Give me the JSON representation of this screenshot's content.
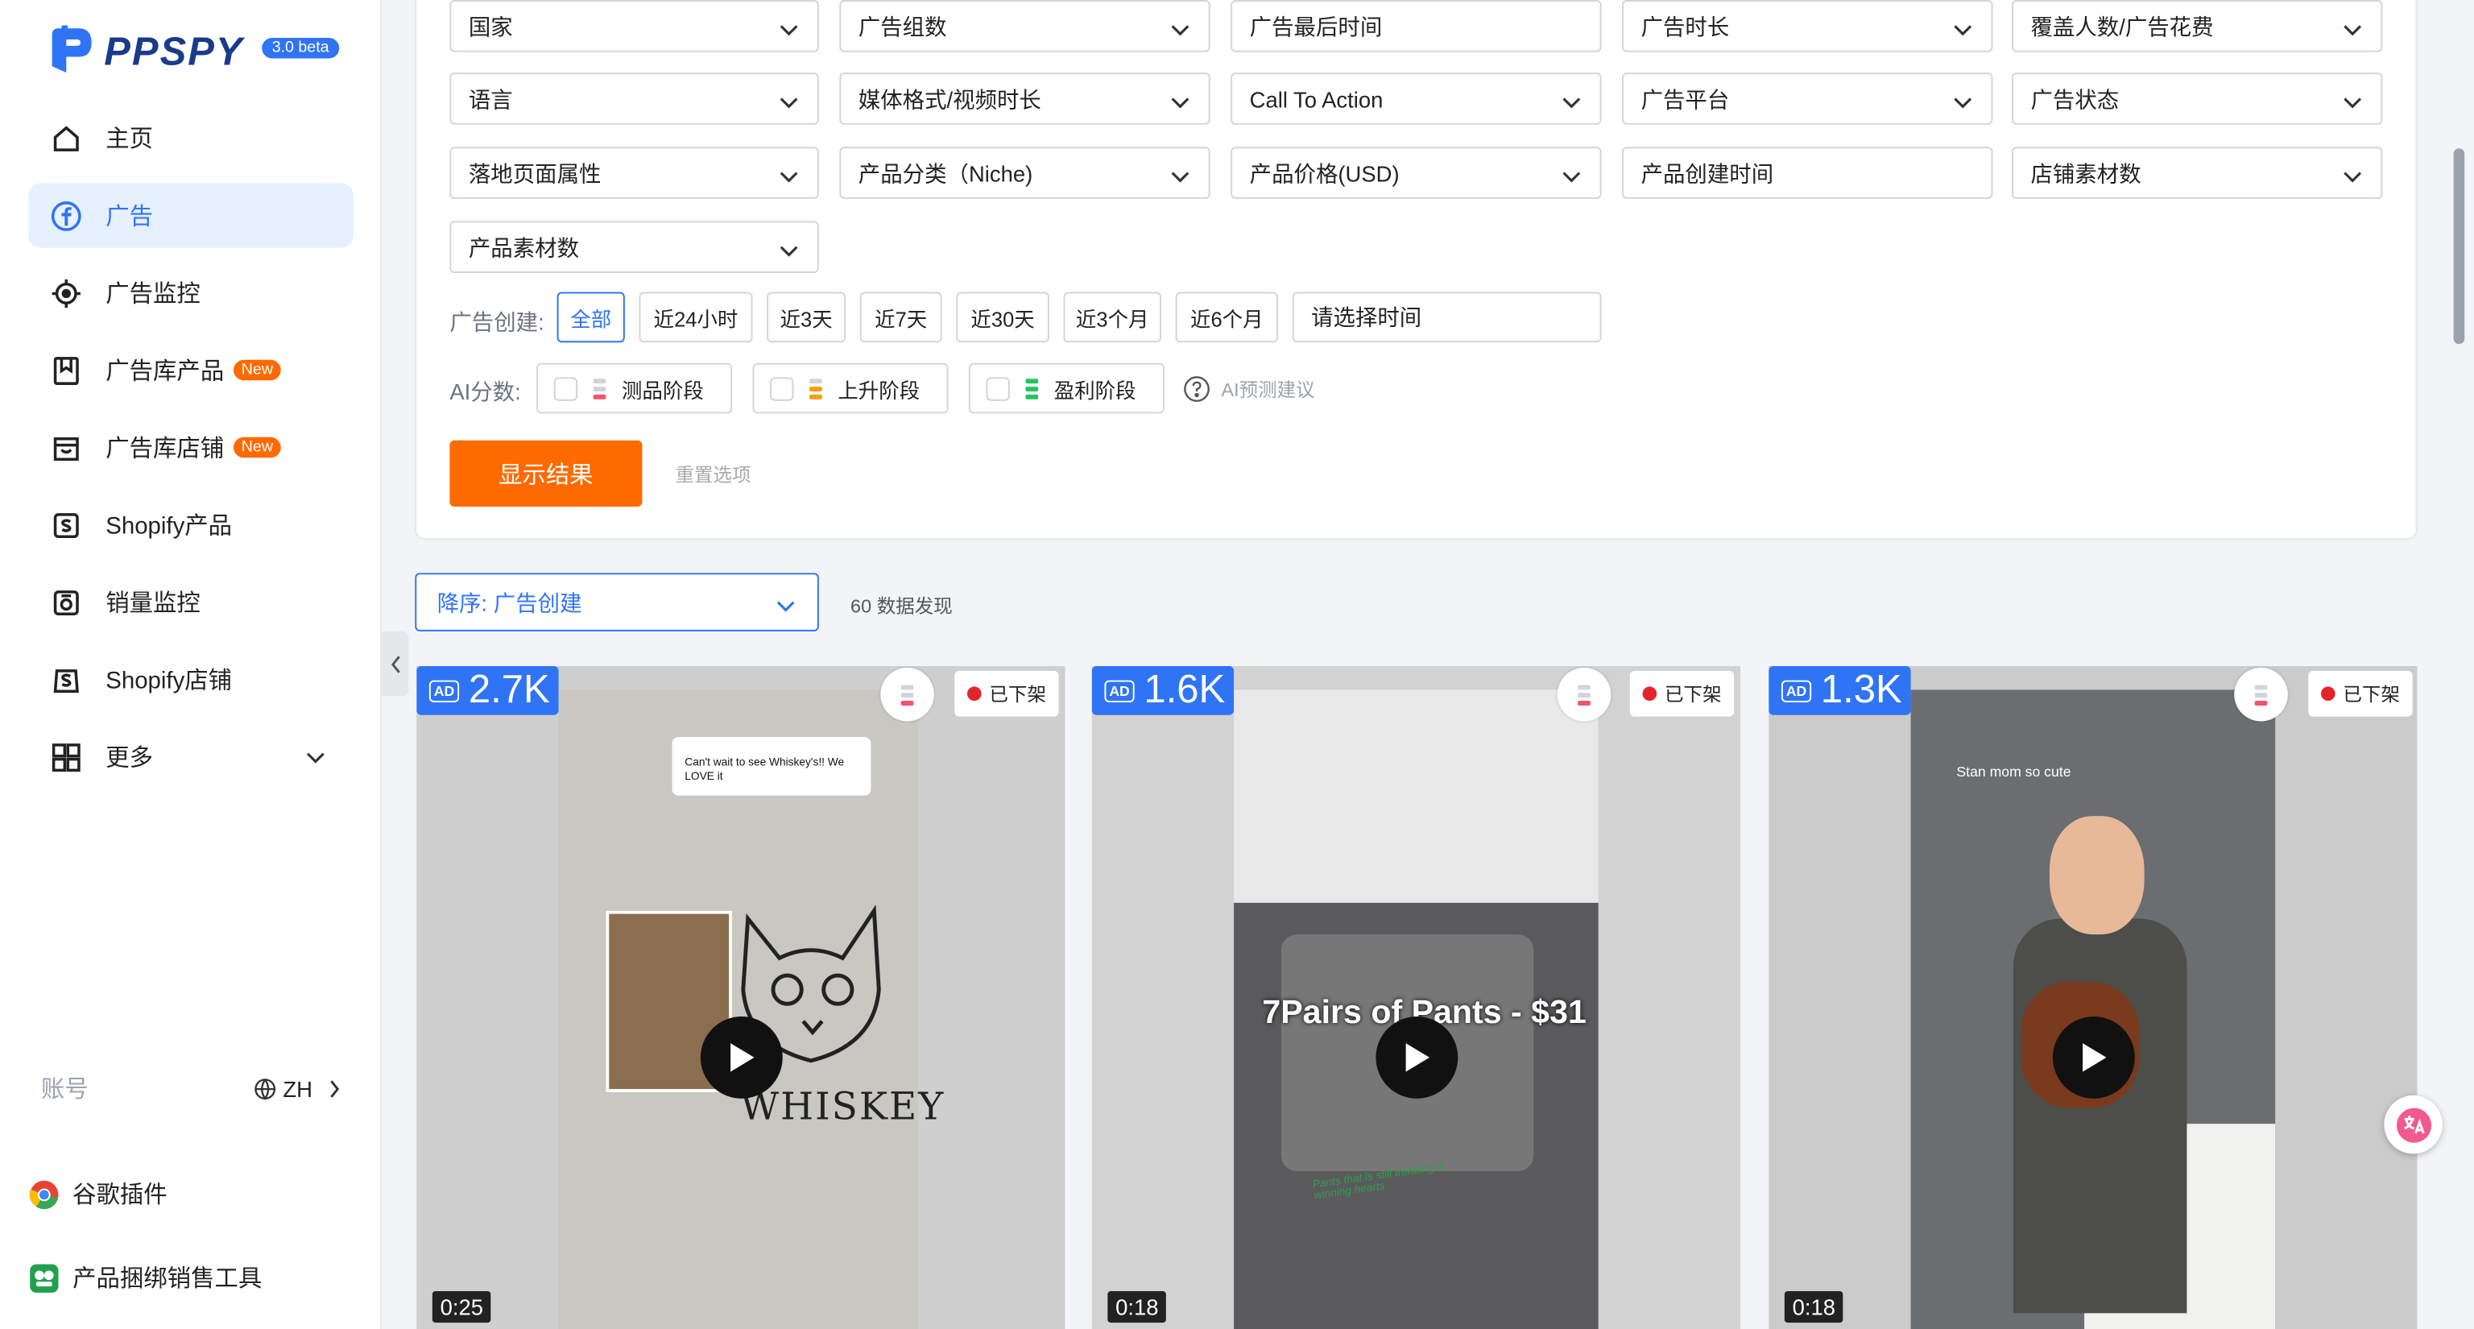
{
  "brand": {
    "name": "PPSPY",
    "version": "3.0 beta"
  },
  "nav": [
    {
      "label": "主页",
      "icon": "home-icon"
    },
    {
      "label": "广告",
      "icon": "facebook-icon",
      "active": true
    },
    {
      "label": "广告监控",
      "icon": "target-icon"
    },
    {
      "label": "广告库产品",
      "icon": "bookmark-icon",
      "badge": "New"
    },
    {
      "label": "广告库店铺",
      "icon": "store-icon",
      "badge": "New"
    },
    {
      "label": "Shopify产品",
      "icon": "shopify-icon"
    },
    {
      "label": "销量监控",
      "icon": "sales-monitor-icon"
    },
    {
      "label": "Shopify店铺",
      "icon": "shopify-store-icon"
    },
    {
      "label": "更多",
      "icon": "grid-icon"
    }
  ],
  "account": {
    "label": "账号",
    "lang": "ZH"
  },
  "plugins": [
    {
      "label": "谷歌插件",
      "icon": "chrome-icon"
    },
    {
      "label": "产品捆绑销售工具",
      "icon": "bundle-tool-icon"
    }
  ],
  "filters": {
    "row1": [
      "国家",
      "广告组数",
      "广告最后时间",
      "广告时长",
      "覆盖人数/广告花费"
    ],
    "row2": [
      "语言",
      "媒体格式/视频时长",
      "Call To Action",
      "广告平台",
      "广告状态"
    ],
    "row3": [
      "落地页面属性",
      "产品分类（Niche)",
      "产品价格(USD)",
      "产品创建时间",
      "店铺素材数"
    ],
    "row4": [
      "产品素材数"
    ],
    "date_label": "广告创建:",
    "date_chips": [
      "全部",
      "近24小时",
      "近3天",
      "近7天",
      "近30天",
      "近3个月",
      "近6个月"
    ],
    "date_placeholder": "请选择时间",
    "ai_label": "AI分数:",
    "ai_stages": [
      "测品阶段",
      "上升阶段",
      "盈利阶段"
    ],
    "ai_help": "AI预测建议",
    "show_button": "显示结果",
    "reset_button": "重置选项"
  },
  "sort": {
    "label": "降序: 广告创建"
  },
  "results_count": "60 数据发现",
  "cards": [
    {
      "reach": "2.7K",
      "status": "已下架",
      "duration": "0:25",
      "caption": "Can't wait to see Whiskey's!! We LOVE it",
      "product_text": "WHISKEY"
    },
    {
      "reach": "1.6K",
      "status": "已下架",
      "duration": "0:18",
      "caption": "7Pairs of Pants - $31",
      "product_text": "Pants that is still trending & winning hearts"
    },
    {
      "reach": "1.3K",
      "status": "已下架",
      "duration": "0:18",
      "caption": "Stan mom so cute",
      "product_text": ""
    }
  ],
  "colors": {
    "accent": "#2f74f5",
    "cta": "#ff6a00",
    "status_red": "#e5242a",
    "stage_red": "#f2546b",
    "stage_orange": "#f59e0b",
    "stage_green": "#22c55e"
  }
}
